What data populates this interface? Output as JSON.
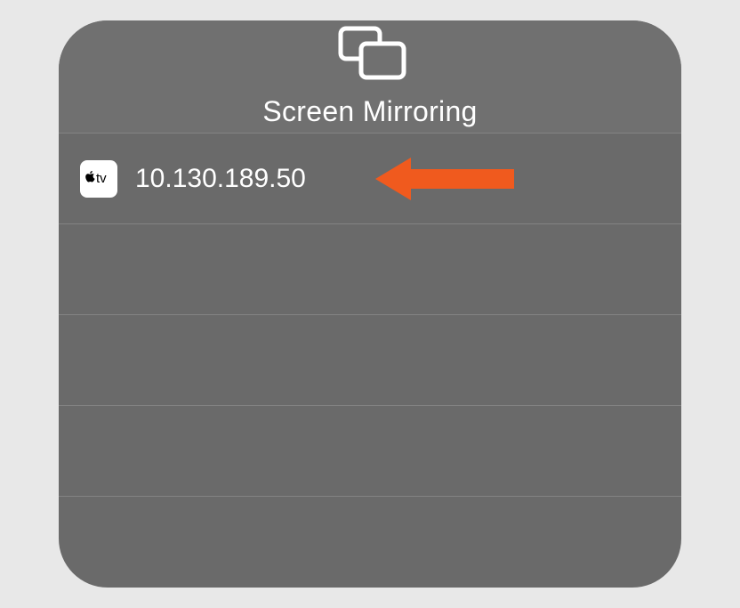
{
  "header": {
    "title": "Screen Mirroring"
  },
  "devices": [
    {
      "icon": "apple-tv",
      "label": "10.130.189.50"
    }
  ],
  "annotation": {
    "color": "#f05a1e"
  }
}
